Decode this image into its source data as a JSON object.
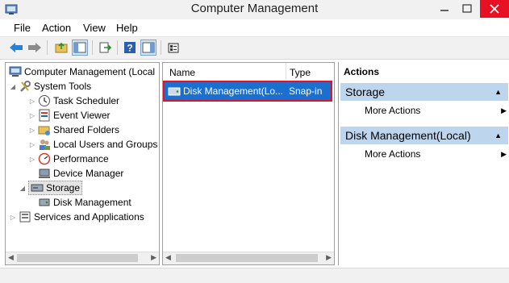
{
  "window": {
    "title": "Computer Management"
  },
  "menu": [
    "File",
    "Action",
    "View",
    "Help"
  ],
  "toolbar": {
    "buttons": [
      "back-arrow-icon",
      "forward-arrow-icon",
      "show-hide-console-tree-icon",
      "up-folder-icon",
      "export-list-icon",
      "help-icon",
      "show-hide-action-pane-icon",
      "properties-icon"
    ]
  },
  "tree": {
    "items": [
      {
        "label": "Computer Management (Local",
        "level": 0,
        "icon": "computer-management-icon"
      },
      {
        "label": "System Tools",
        "level": 1,
        "icon": "tools-icon"
      },
      {
        "label": "Task Scheduler",
        "level": 2,
        "icon": "clock-icon"
      },
      {
        "label": "Event Viewer",
        "level": 2,
        "icon": "event-viewer-icon"
      },
      {
        "label": "Shared Folders",
        "level": 2,
        "icon": "shared-folder-icon"
      },
      {
        "label": "Local Users and Groups",
        "level": 2,
        "icon": "users-icon"
      },
      {
        "label": "Performance",
        "level": 2,
        "icon": "performance-icon"
      },
      {
        "label": "Device Manager",
        "level": 2,
        "icon": "device-manager-icon"
      },
      {
        "label": "Storage",
        "level": 1,
        "icon": "storage-icon"
      },
      {
        "label": "Disk Management",
        "level": 2,
        "icon": "disk-icon"
      },
      {
        "label": "Services and Applications",
        "level": 1,
        "icon": "services-icon"
      }
    ]
  },
  "list": {
    "columns": {
      "name": "Name",
      "type": "Type"
    },
    "rows": [
      {
        "name": "Disk Management(Lo...",
        "type": "Snap-in"
      }
    ]
  },
  "actions": {
    "title": "Actions",
    "sections": [
      {
        "header": "Storage",
        "items": [
          "More Actions"
        ]
      },
      {
        "header": "Disk Management(Local)",
        "items": [
          "More Actions"
        ]
      }
    ]
  },
  "colors": {
    "selection": "#1a6fcf",
    "highlight_border": "#e81123",
    "action_header": "#bdd6ee",
    "close_button": "#e81123"
  }
}
